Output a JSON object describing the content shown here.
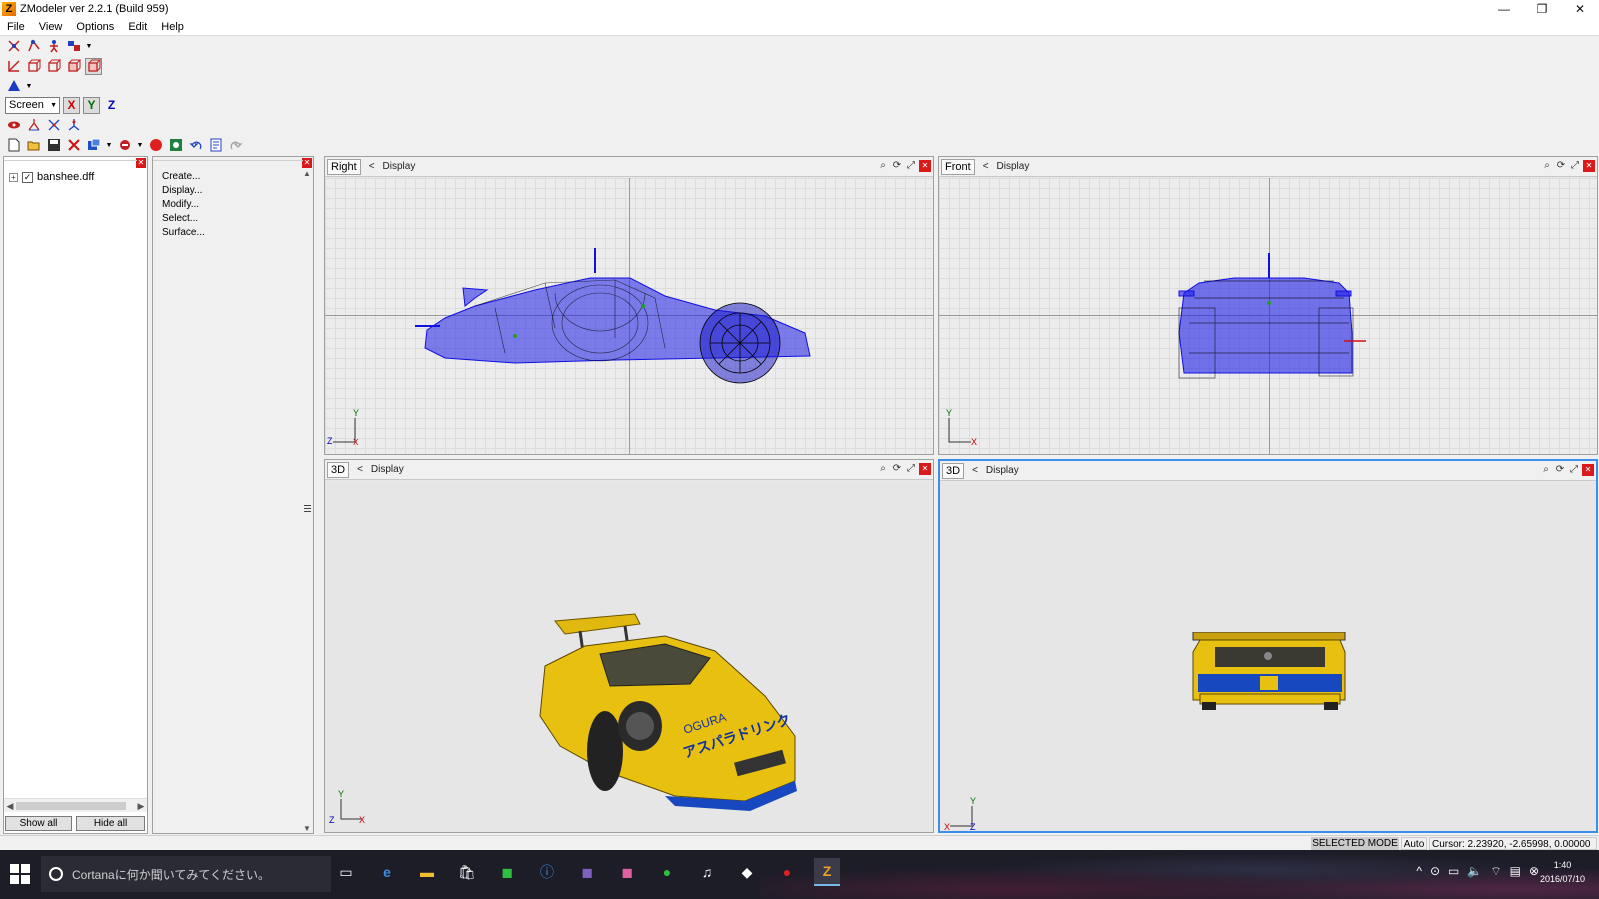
{
  "window": {
    "title": "ZModeler ver 2.2.1 (Build 959)",
    "app_icon_letter": "Z",
    "minimize": "—",
    "restore": "❐",
    "close": "✕"
  },
  "menu": [
    "File",
    "View",
    "Options",
    "Edit",
    "Help"
  ],
  "toolbar": {
    "coord_system": "Screen",
    "axis_x": "X",
    "axis_y": "Y",
    "axis_z": "Z"
  },
  "tree": {
    "items": [
      {
        "label": "banshee.dff",
        "expander": "+",
        "checked": "✓"
      }
    ],
    "show_all": "Show all",
    "hide_all": "Hide all"
  },
  "commands": [
    "Create...",
    "Display...",
    "Modify...",
    "Select...",
    "Surface..."
  ],
  "viewports": [
    {
      "name": "Right",
      "display": "Display",
      "arrow": "<"
    },
    {
      "name": "Front",
      "display": "Display",
      "arrow": "<"
    },
    {
      "name": "3D",
      "display": "Display",
      "arrow": "<"
    },
    {
      "name": "3D",
      "display": "Display",
      "arrow": "<"
    }
  ],
  "gizmo": {
    "right": {
      "up": "Y",
      "side": "Z",
      "origin": "X"
    },
    "front": {
      "up": "Y",
      "side": "X"
    },
    "persp_left": {
      "up": "Y",
      "side": "Z",
      "origin": "X"
    },
    "persp_right": {
      "up": "Y",
      "side": "Z",
      "origin": "X"
    }
  },
  "status": {
    "mode": "SELECTED MODE",
    "auto": "Auto",
    "cursor": "Cursor: 2.23920, -2.65998, 0.00000"
  },
  "taskbar": {
    "cortana_placeholder": "Cortanaに何か聞いてみてください。",
    "time": "1:40",
    "date": "2016/07/10"
  },
  "colors": {
    "wireframe": "#1010e0",
    "car_yellow": "#e8c010",
    "car_blue": "#1848c0",
    "active_border": "#3c8ee8"
  },
  "icons": {
    "search": "search-icon",
    "rotate": "rotate-view-icon",
    "maximize": "maximize-viewport-icon",
    "close": "close-viewport-icon"
  }
}
